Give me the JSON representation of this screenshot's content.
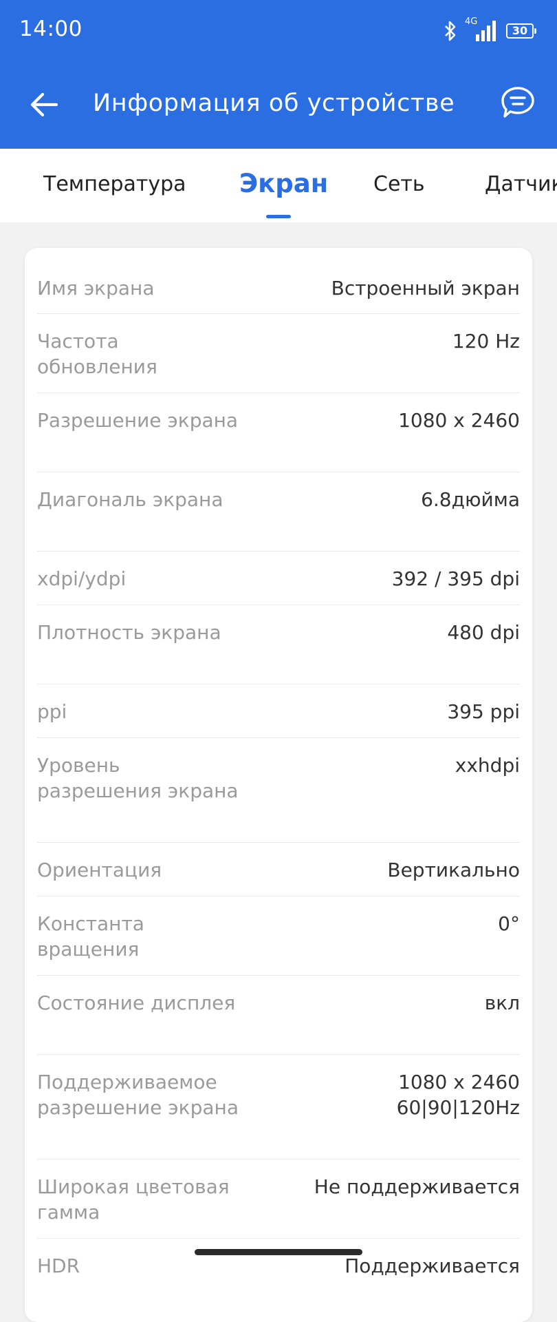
{
  "status_bar": {
    "time": "14:00",
    "network": "4G",
    "battery": "30",
    "icons": [
      "bluetooth-icon",
      "signal-icon",
      "battery-icon"
    ]
  },
  "app_bar": {
    "title": "Информация об устройстве",
    "back_icon": "arrow-left-icon",
    "feedback_icon": "chat-bubble-icon"
  },
  "tabs": [
    {
      "label": "Температура",
      "active": false
    },
    {
      "label": "Экран",
      "active": true
    },
    {
      "label": "Сеть",
      "active": false
    },
    {
      "label": "Датчик",
      "active": false
    }
  ],
  "rows": [
    {
      "label": "Имя экрана",
      "value": "Встроенный экран"
    },
    {
      "label": "Частота обновления",
      "value": "120 Hz"
    },
    {
      "label": "Разрешение экрана",
      "value": "1080 x 2460"
    },
    {
      "label": "Диагональ экрана",
      "value": "6.8дюйма"
    },
    {
      "label": "xdpi/ydpi",
      "value": "392 / 395 dpi"
    },
    {
      "label": "Плотность экрана",
      "value": "480 dpi"
    },
    {
      "label": "ppi",
      "value": "395 ppi"
    },
    {
      "label": "Уровень разрешения экрана",
      "value": "xxhdpi"
    },
    {
      "label": "Ориентация",
      "value": "Вертикально"
    },
    {
      "label": "Константа вращения",
      "value": "0°"
    },
    {
      "label": "Состояние дисплея",
      "value": "вкл"
    },
    {
      "label": "Поддерживаемое разрешение экрана",
      "value": "1080 x 2460\n60|90|120Hz"
    },
    {
      "label": "Широкая цветовая гамма",
      "value": "Не поддерживается"
    },
    {
      "label": "HDR",
      "value": "Поддерживается"
    }
  ],
  "colors": {
    "accent": "#2a6ee2",
    "background": "#f2f2f2",
    "label": "#9a9a9a",
    "value": "#333333"
  }
}
